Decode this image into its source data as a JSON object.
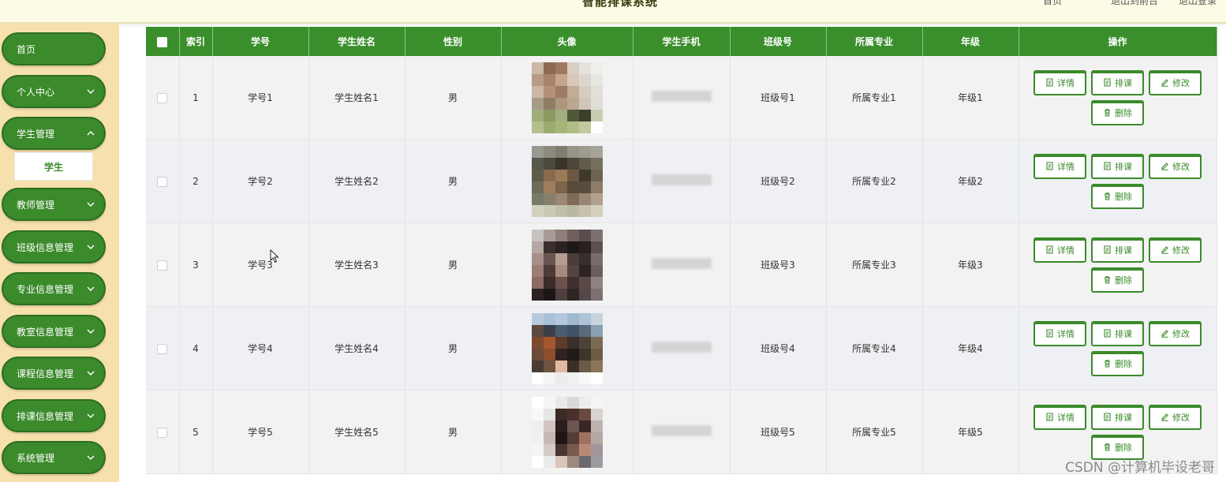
{
  "header": {
    "title": "智能排课系统",
    "right_items": [
      "首页",
      "退出到前台",
      "退出登录"
    ]
  },
  "sidebar": {
    "items": [
      {
        "label": "首页",
        "has_chevron": false
      },
      {
        "label": "个人中心",
        "has_chevron": true
      },
      {
        "label": "学生管理",
        "has_chevron": true
      },
      {
        "label": "教师管理",
        "has_chevron": true
      },
      {
        "label": "班级信息管理",
        "has_chevron": true
      },
      {
        "label": "专业信息管理",
        "has_chevron": true
      },
      {
        "label": "教室信息管理",
        "has_chevron": true
      },
      {
        "label": "课程信息管理",
        "has_chevron": true
      },
      {
        "label": "排课信息管理",
        "has_chevron": true
      },
      {
        "label": "系统管理",
        "has_chevron": true
      }
    ],
    "sub_item": "学生"
  },
  "table": {
    "headers": [
      "",
      "索引",
      "学号",
      "学生姓名",
      "性别",
      "头像",
      "学生手机",
      "班级号",
      "所属专业",
      "年级",
      "操作"
    ],
    "rows": [
      {
        "index": "1",
        "id": "学号1",
        "name": "学生姓名1",
        "gender": "男",
        "class": "班级号1",
        "major": "所属专业1",
        "grade": "年级1"
      },
      {
        "index": "2",
        "id": "学号2",
        "name": "学生姓名2",
        "gender": "男",
        "class": "班级号2",
        "major": "所属专业2",
        "grade": "年级2"
      },
      {
        "index": "3",
        "id": "学号3",
        "name": "学生姓名3",
        "gender": "男",
        "class": "班级号3",
        "major": "所属专业3",
        "grade": "年级3"
      },
      {
        "index": "4",
        "id": "学号4",
        "name": "学生姓名4",
        "gender": "男",
        "class": "班级号4",
        "major": "所属专业4",
        "grade": "年级4"
      },
      {
        "index": "5",
        "id": "学号5",
        "name": "学生姓名5",
        "gender": "男",
        "class": "班级号5",
        "major": "所属专业5",
        "grade": "年级5"
      }
    ],
    "actions": {
      "detail": "详情",
      "schedule": "排课",
      "edit": "修改",
      "delete": "删除"
    }
  },
  "watermark": "CSDN @计算机毕设老哥",
  "colors": {
    "accent": "#3b8a2b",
    "sidebar_bg": "#f6e0ac",
    "header_bg": "#3a8f2c"
  }
}
